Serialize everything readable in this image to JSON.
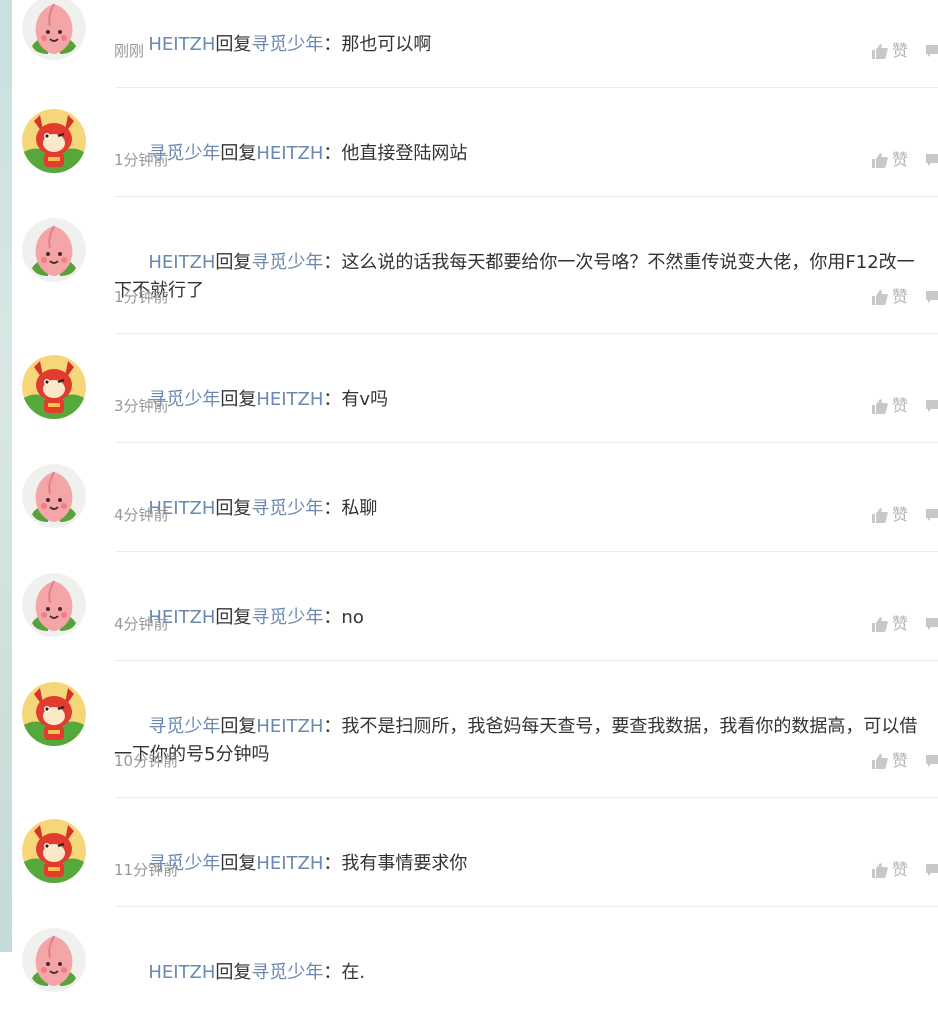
{
  "like_label": "赞",
  "comments": [
    {
      "author": "HEITZH",
      "reply_word": "回复",
      "target": "寻觅少年",
      "colon": "：",
      "text": "那也可以啊",
      "time": "刚刚",
      "avatar": "peach-avatar"
    },
    {
      "author": "寻觅少年",
      "reply_word": "回复",
      "target": "HEITZH",
      "colon": "：",
      "text": "他直接登陆网站",
      "time": "1分钟前",
      "avatar": "fox-avatar"
    },
    {
      "author": "HEITZH",
      "reply_word": "回复",
      "target": "寻觅少年",
      "colon": "：",
      "text": "这么说的话我每天都要给你一次号咯？不然重传说变大佬，你用F12改一下不就行了",
      "time": "1分钟前",
      "avatar": "peach-avatar"
    },
    {
      "author": "寻觅少年",
      "reply_word": "回复",
      "target": "HEITZH",
      "colon": "：",
      "text": "有v吗",
      "time": "3分钟前",
      "avatar": "fox-avatar"
    },
    {
      "author": "HEITZH",
      "reply_word": "回复",
      "target": "寻觅少年",
      "colon": "：",
      "text": "私聊",
      "time": "4分钟前",
      "avatar": "peach-avatar"
    },
    {
      "author": "HEITZH",
      "reply_word": "回复",
      "target": "寻觅少年",
      "colon": "：",
      "text": "no",
      "time": "4分钟前",
      "avatar": "peach-avatar"
    },
    {
      "author": "寻觅少年",
      "reply_word": "回复",
      "target": "HEITZH",
      "colon": "：",
      "text": "我不是扫厕所，我爸妈每天查号，要查我数据，我看你的数据高，可以借一下你的号5分钟吗",
      "time": "10分钟前",
      "avatar": "fox-avatar"
    },
    {
      "author": "寻觅少年",
      "reply_word": "回复",
      "target": "HEITZH",
      "colon": "：",
      "text": "我有事情要求你",
      "time": "11分钟前",
      "avatar": "fox-avatar"
    },
    {
      "author": "HEITZH",
      "reply_word": "回复",
      "target": "寻觅少年",
      "colon": "：",
      "text": "在.",
      "time": "",
      "avatar": "peach-avatar"
    }
  ],
  "colors": {
    "username": "#6a88b1",
    "text": "#333333",
    "meta": "#999999",
    "like": "#b5b5b5"
  }
}
